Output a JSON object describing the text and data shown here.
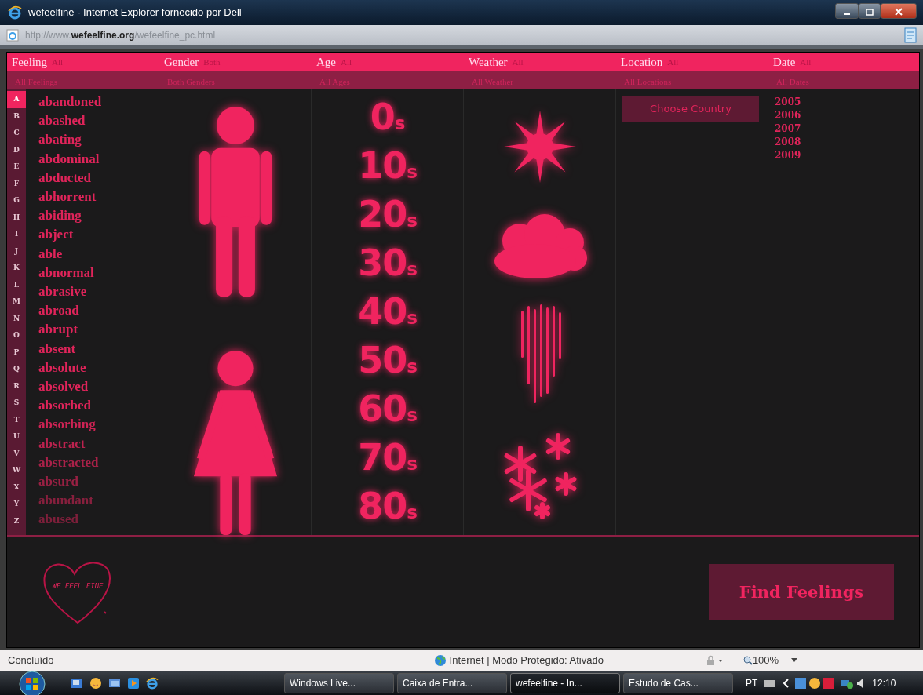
{
  "window": {
    "title": "wefeelfine - Internet Explorer fornecido por Dell"
  },
  "address_bar": {
    "url": "http://www.**wefeelfine.org**/wefeelfine_pc.html"
  },
  "filters": [
    {
      "label": "Feeling",
      "value": "All",
      "summary": "All Feelings"
    },
    {
      "label": "Gender",
      "value": "Both",
      "summary": "Both Genders"
    },
    {
      "label": "Age",
      "value": "All",
      "summary": "All Ages"
    },
    {
      "label": "Weather",
      "value": "All",
      "summary": "All Weather"
    },
    {
      "label": "Location",
      "value": "All",
      "summary": "All Locations"
    },
    {
      "label": "Date",
      "value": "All",
      "summary": "All Dates"
    }
  ],
  "letters": [
    {
      "label": "A",
      "selected": true
    },
    {
      "label": "B",
      "selected": false
    },
    {
      "label": "C",
      "selected": false
    },
    {
      "label": "D",
      "selected": false
    },
    {
      "label": "E",
      "selected": false
    },
    {
      "label": "F",
      "selected": false
    },
    {
      "label": "G",
      "selected": false
    },
    {
      "label": "H",
      "selected": false
    },
    {
      "label": "I",
      "selected": false
    },
    {
      "label": "J",
      "selected": false
    },
    {
      "label": "K",
      "selected": false
    },
    {
      "label": "L",
      "selected": false
    },
    {
      "label": "M",
      "selected": false
    },
    {
      "label": "N",
      "selected": false
    },
    {
      "label": "O",
      "selected": false
    },
    {
      "label": "P",
      "selected": false
    },
    {
      "label": "Q",
      "selected": false
    },
    {
      "label": "R",
      "selected": false
    },
    {
      "label": "S",
      "selected": false
    },
    {
      "label": "T",
      "selected": false
    },
    {
      "label": "U",
      "selected": false
    },
    {
      "label": "V",
      "selected": false
    },
    {
      "label": "W",
      "selected": false
    },
    {
      "label": "X",
      "selected": false
    },
    {
      "label": "Y",
      "selected": false
    },
    {
      "label": "Z",
      "selected": false
    }
  ],
  "feelings": [
    "abandoned",
    "abashed",
    "abating",
    "abdominal",
    "abducted",
    "abhorrent",
    "abiding",
    "abject",
    "able",
    "abnormal",
    "abrasive",
    "abroad",
    "abrupt",
    "absent",
    "absolute",
    "absolved",
    "absorbed",
    "absorbing",
    "abstract",
    "abstracted",
    "absurd",
    "abundant",
    "abused"
  ],
  "genders": [
    {
      "kind": "male"
    },
    {
      "kind": "female"
    }
  ],
  "ages": [
    "0$_{s}$",
    "10$_{s}$",
    "20$_{s}$",
    "30$_{s}$",
    "40$_{s}$",
    "50$_{s}$",
    "60$_{s}$",
    "70$_{s}$",
    "80$_{s}$"
  ],
  "weather": [
    {
      "kind": "sun"
    },
    {
      "kind": "cloud"
    },
    {
      "kind": "rain"
    },
    {
      "kind": "snow"
    }
  ],
  "location": {
    "button": "Choose Country"
  },
  "dates": [
    "2005",
    "2006",
    "2007",
    "2008",
    "2009"
  ],
  "logo": {
    "text": "WE FEEL FINE"
  },
  "find_button": "Find Feelings",
  "status_bar": {
    "text": "Concluído",
    "zone": "Internet | Modo Protegido: Ativado",
    "zoom": "100%"
  },
  "taskbar": {
    "tasks": [
      {
        "label": "Windows Live...",
        "selected": false
      },
      {
        "label": "Caixa de Entra...",
        "selected": false
      },
      {
        "label": "wefeelfine - In...",
        "selected": true
      },
      {
        "label": "Estudo de Cas...",
        "selected": false
      }
    ],
    "language": "PT",
    "clock": "12:10"
  }
}
